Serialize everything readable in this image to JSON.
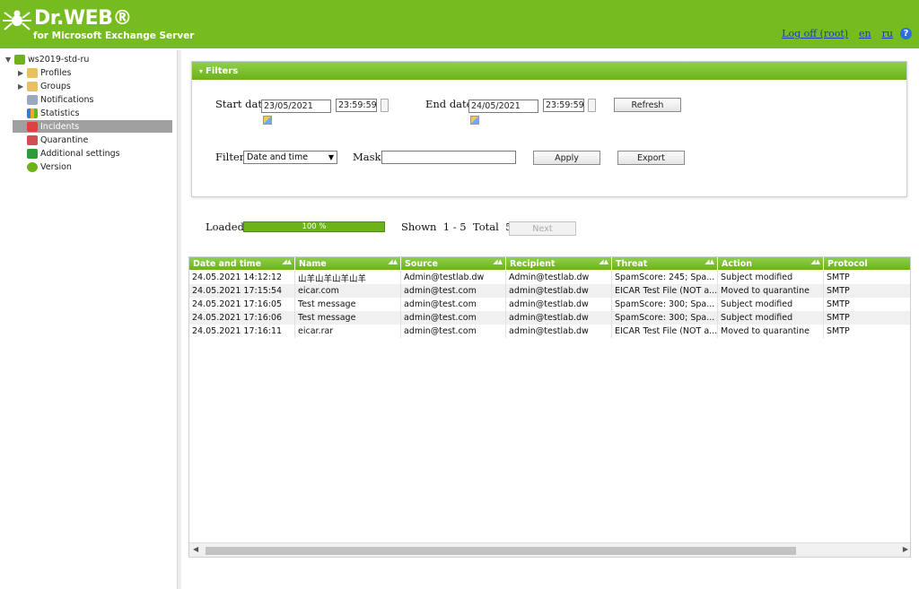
{
  "header": {
    "brand": "Dr.WEB®",
    "subtitle": "for Microsoft Exchange Server",
    "logoff_label": "Log off (root)",
    "lang_en": "en",
    "lang_ru": "ru",
    "help_glyph": "?"
  },
  "tree": {
    "root": "ws2019-std-ru",
    "items": [
      {
        "label": "Profiles",
        "icon": "folder-icon"
      },
      {
        "label": "Groups",
        "icon": "folder-icon"
      },
      {
        "label": "Notifications",
        "icon": "megaphone-icon"
      },
      {
        "label": "Statistics",
        "icon": "chart-icon"
      },
      {
        "label": "Incidents",
        "icon": "incident-icon"
      },
      {
        "label": "Quarantine",
        "icon": "quarantine-icon"
      },
      {
        "label": "Additional settings",
        "icon": "shield-icon"
      },
      {
        "label": "Version",
        "icon": "info-icon"
      }
    ],
    "selected": "Incidents"
  },
  "filters": {
    "title": "Filters",
    "start_label": "Start date",
    "start_date": "23/05/2021",
    "start_time": "23:59:59",
    "end_label": "End date",
    "end_date": "24/05/2021",
    "end_time": "23:59:59",
    "refresh": "Refresh",
    "filter_label": "Filter",
    "filter_value": "Date and time",
    "mask_label": "Mask",
    "mask_value": "",
    "apply": "Apply",
    "export": "Export"
  },
  "status": {
    "loaded_label": "Loaded",
    "progress": "100 %",
    "shown": "Shown  1 - 5  Total  5",
    "next": "Next"
  },
  "grid": {
    "columns": [
      "Date and time",
      "Name",
      "Source",
      "Recipient",
      "Threat",
      "Action",
      "Protocol"
    ],
    "rows": [
      [
        "24.05.2021 14:12:12",
        "山羊山羊山羊山羊",
        "Admin@testlab.dw",
        "Admin@testlab.dw",
        "SpamScore: 245; Spa...",
        "Subject modified",
        "SMTP"
      ],
      [
        "24.05.2021 17:15:54",
        "eicar.com",
        "admin@test.com",
        "admin@testlab.dw",
        "EICAR Test File (NOT a...",
        "Moved to quarantine",
        "SMTP"
      ],
      [
        "24.05.2021 17:16:05",
        "Test message",
        "admin@test.com",
        "admin@testlab.dw",
        "SpamScore: 300; Spa...",
        "Subject modified",
        "SMTP"
      ],
      [
        "24.05.2021 17:16:06",
        "Test message",
        "admin@test.com",
        "admin@testlab.dw",
        "SpamScore: 300; Spa...",
        "Subject modified",
        "SMTP"
      ],
      [
        "24.05.2021 17:16:11",
        "eicar.rar",
        "admin@test.com",
        "admin@testlab.dw",
        "EICAR Test File (NOT a...",
        "Moved to quarantine",
        "SMTP"
      ]
    ]
  },
  "colors": {
    "accent": "#76bc21",
    "selected_row": "#a0a0a0",
    "link": "#1a3cb8"
  }
}
